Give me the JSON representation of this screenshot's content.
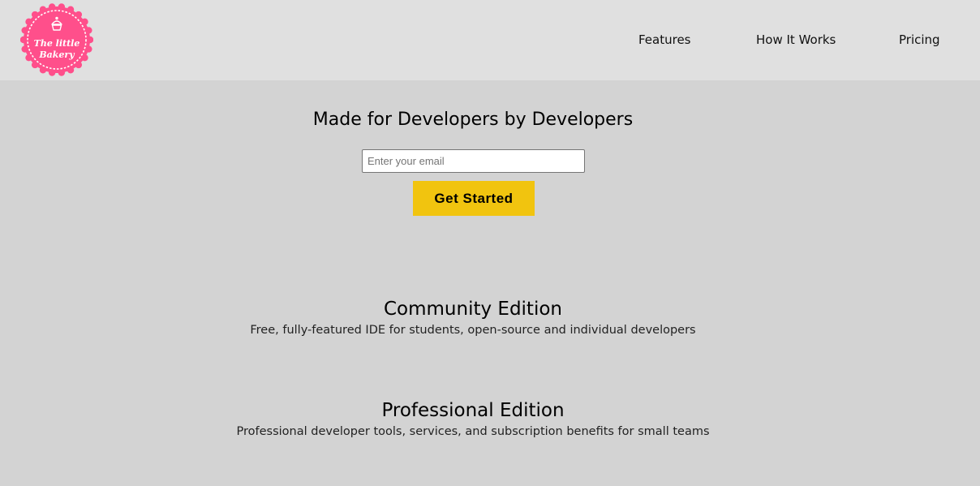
{
  "header": {
    "logo": {
      "icon": "cupcake-icon",
      "text_line1": "The little",
      "text_line2": "Bakery",
      "badge_color": "#ff4f8b"
    },
    "nav": [
      {
        "label": "Features"
      },
      {
        "label": "How It Works"
      },
      {
        "label": "Pricing"
      }
    ]
  },
  "hero": {
    "title": "Made for Developers by Developers",
    "email_placeholder": "Enter your email",
    "cta_label": "Get Started",
    "cta_color": "#f1c40f"
  },
  "editions": [
    {
      "title": "Community Edition",
      "description": "Free, fully-featured IDE for students, open-source and individual developers"
    },
    {
      "title": "Professional Edition",
      "description": "Professional developer tools, services, and subscription benefits for small teams"
    }
  ]
}
